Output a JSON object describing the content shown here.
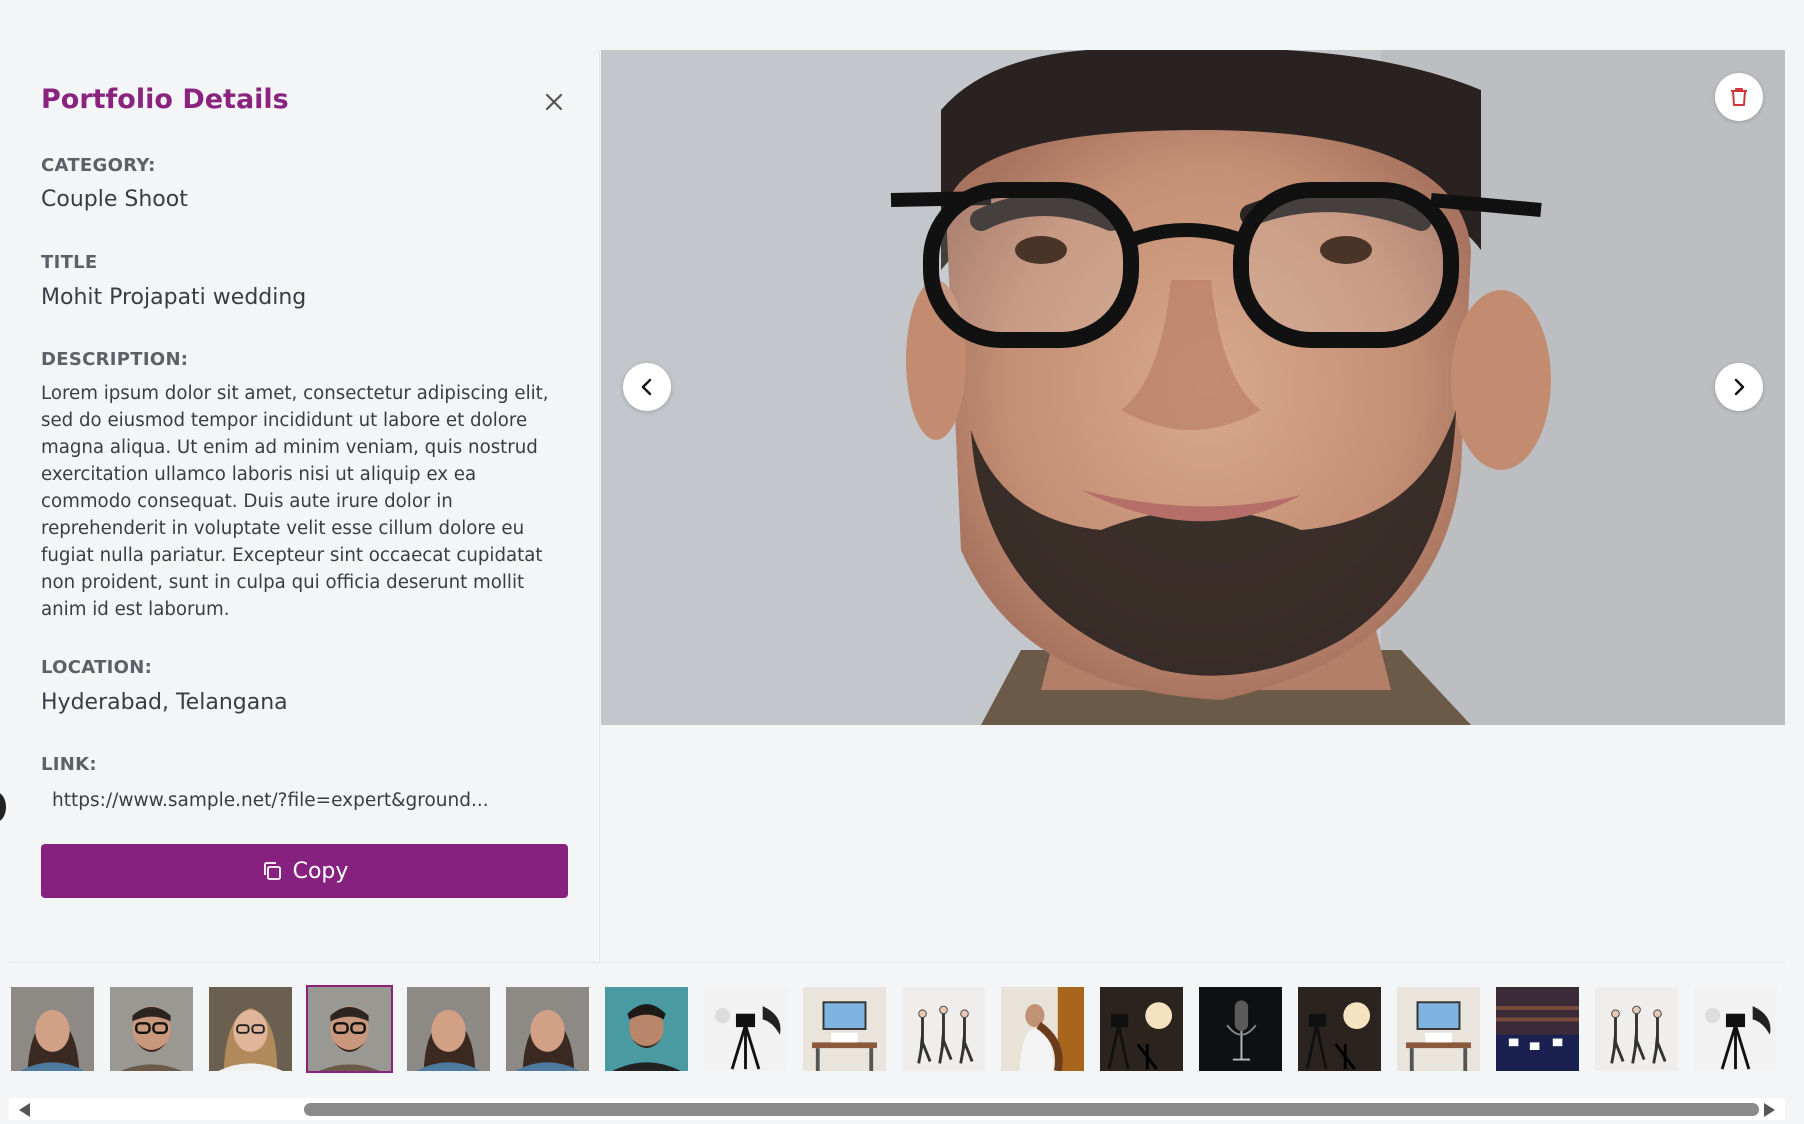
{
  "panel": {
    "title": "Portfolio Details",
    "close_icon": "close-icon",
    "category_label": "CATEGORY:",
    "category_value": "Couple Shoot",
    "title_label": "TITLE",
    "title_value": "Mohit Projapati wedding",
    "description_label": "DESCRIPTION:",
    "description_value": "Lorem ipsum dolor sit amet, consectetur adipiscing elit, sed do eiusmod tempor incididunt ut labore et dolore magna aliqua. Ut enim ad minim veniam, quis nostrud exercitation ullamco laboris nisi ut aliquip ex ea commodo consequat. Duis aute irure dolor in reprehenderit in voluptate velit esse cillum dolore eu fugiat nulla pariatur. Excepteur sint occaecat cupidatat non proident, sunt in culpa qui officia deserunt mollit anim id est laborum.",
    "location_label": "LOCATION:",
    "location_value": "Hyderabad, Telangana",
    "link_label": "LINK:",
    "link_value": "https://www.sample.net/?file=expert&ground...",
    "copy_label": "Copy",
    "copy_icon": "copy-icon"
  },
  "viewer": {
    "delete_icon": "trash-icon",
    "prev_icon": "chevron-left-icon",
    "next_icon": "chevron-right-icon"
  },
  "colors": {
    "accent": "#8a2380",
    "button": "#87217f",
    "background": "#f4f5f7"
  },
  "thumbnails": [
    {
      "kind": "woman-portrait",
      "active": false
    },
    {
      "kind": "man-glasses-portrait",
      "active": false
    },
    {
      "kind": "woman-glasses-portrait",
      "active": false
    },
    {
      "kind": "man-glasses-portrait",
      "active": true
    },
    {
      "kind": "woman-portrait",
      "active": false
    },
    {
      "kind": "woman-portrait",
      "active": false
    },
    {
      "kind": "man-portrait",
      "active": false
    },
    {
      "kind": "studio-tripod",
      "active": false
    },
    {
      "kind": "office-screen",
      "active": false
    },
    {
      "kind": "ballet-dancers",
      "active": false
    },
    {
      "kind": "cellist",
      "active": false
    },
    {
      "kind": "studio-dark",
      "active": false
    },
    {
      "kind": "microphone",
      "active": false
    },
    {
      "kind": "studio-dark",
      "active": false
    },
    {
      "kind": "office-screen",
      "active": false
    },
    {
      "kind": "concert-hall",
      "active": false
    },
    {
      "kind": "ballet-dancers",
      "active": false
    },
    {
      "kind": "studio-tripod",
      "active": false
    }
  ]
}
